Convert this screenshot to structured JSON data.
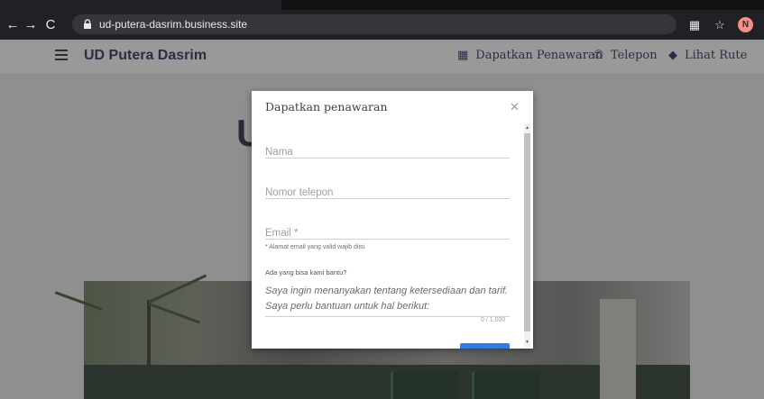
{
  "browser": {
    "url": "ud-putera-dasrim.business.site",
    "avatar_letter": "N"
  },
  "site": {
    "brand": "UD Putera Dasrim",
    "nav": [
      {
        "label": "Dapatkan Penawaran",
        "icon": "quote-icon"
      },
      {
        "label": "Telepon",
        "icon": "phone-icon"
      },
      {
        "label": "Lihat Rute",
        "icon": "directions-icon"
      }
    ],
    "hero_title_partial": "U"
  },
  "dialog": {
    "title": "Dapatkan penawaran",
    "name_placeholder": "Nama",
    "phone_placeholder": "Nomor telepon",
    "email_placeholder": "Email *",
    "email_hint": "* Alamat email yang valid wajib diisi.",
    "help_label": "Ada yang bisa kami bantu?",
    "message": "Saya ingin menanyakan tentang ketersediaan dan tarif. Saya perlu bantuan untuk hal berikut:",
    "counter": "0 / 1.000"
  },
  "colors": {
    "brand": "#34305e",
    "submit": "#2f7de0"
  }
}
